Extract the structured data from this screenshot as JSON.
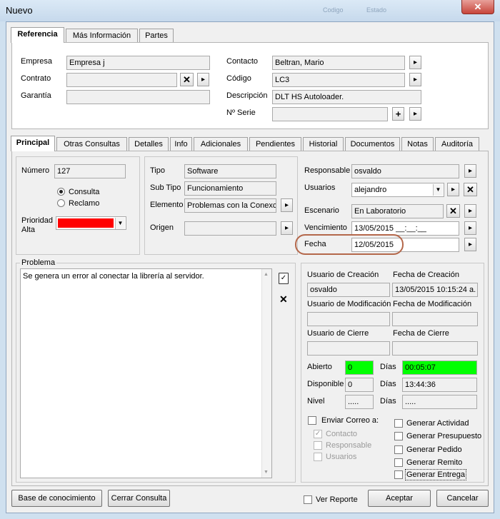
{
  "window": {
    "title": "Nuevo",
    "ghost1": "Codigo",
    "ghost2": "Estado",
    "close": "✕"
  },
  "tabs_top": [
    "Referencia",
    "Más Información",
    "Partes"
  ],
  "ref": {
    "empresa_label": "Empresa",
    "empresa_value": "Empresa j",
    "contrato_label": "Contrato",
    "contrato_value": "",
    "garantia_label": "Garantía",
    "garantia_value": "",
    "contacto_label": "Contacto",
    "contacto_value": "Beltran, Mario",
    "codigo_label": "Código",
    "codigo_value": "LC3",
    "descripcion_label": "Descripción",
    "descripcion_value": "DLT HS Autoloader.",
    "serie_label": "Nº Serie",
    "serie_value": ""
  },
  "tabs_main": [
    "Principal",
    "Otras Consultas",
    "Detalles",
    "Info",
    "Adicionales",
    "Pendientes",
    "Historial",
    "Documentos",
    "Notas",
    "Auditoría"
  ],
  "principal": {
    "numero_label": "Número",
    "numero_value": "127",
    "radio_consulta": "Consulta",
    "radio_reclamo": "Reclamo",
    "prioridad_label": "Prioridad",
    "prioridad_value": "Alta",
    "prioridad_color": "#ff0000",
    "tipo_label": "Tipo",
    "tipo_value": "Software",
    "subtipo_label": "Sub Tipo",
    "subtipo_value": "Funcionamiento",
    "elemento_label": "Elemento",
    "elemento_value": "Problemas con la Conexci",
    "origen_label": "Origen",
    "origen_value": "",
    "responsable_label": "Responsable",
    "responsable_value": "osvaldo",
    "usuarios_label": "Usuarios",
    "usuarios_value": "alejandro",
    "escenario_label": "Escenario",
    "escenario_value": "En Laboratorio",
    "vencimiento_label": "Vencimiento",
    "vencimiento_value": "13/05/2015 __:__:__",
    "fecha_label": "Fecha",
    "fecha_value": "12/05/2015"
  },
  "problema": {
    "label": "Problema",
    "text": "Se genera un error al conectar la librería al servidor."
  },
  "audit": {
    "usr_creacion_label": "Usuario de Creación",
    "usr_creacion_value": "osvaldo",
    "fecha_creacion_label": "Fecha de Creación",
    "fecha_creacion_value": "13/05/2015 10:15:24 a.",
    "usr_mod_label": "Usuario de Modificación",
    "usr_mod_value": "",
    "fecha_mod_label": "Fecha de Modificación",
    "fecha_mod_value": "",
    "usr_cierre_label": "Usuario de Cierre",
    "usr_cierre_value": "",
    "fecha_cierre_label": "Fecha de Cierre",
    "fecha_cierre_value": ""
  },
  "tiempos": {
    "abierto_label": "Abierto",
    "abierto_value": "0",
    "abierto_dias_label": "Días",
    "abierto_dias_value": "00:05:07",
    "disponible_label": "Disponible",
    "disponible_value": "0",
    "disponible_dias_label": "Días",
    "disponible_dias_value": "13:44:36",
    "nivel_label": "Nivel",
    "nivel_value": ".....",
    "nivel_dias_label": "Días",
    "nivel_dias_value": ".....",
    "highlight_color": "#00ff00"
  },
  "correo": {
    "enviar_label": "Enviar Correo a:",
    "contacto_label": "Contacto",
    "responsable_label": "Responsable",
    "usuarios_label": "Usuarios"
  },
  "generar": [
    "Generar Actividad",
    "Generar Presupuesto",
    "Generar Pedido",
    "Generar Remito",
    "Generar Entrega"
  ],
  "footer": {
    "base_label": "Base de conocimiento",
    "cerrar_label": "Cerrar Consulta",
    "ver_reporte_label": "Ver Reporte",
    "aceptar_label": "Aceptar",
    "cancelar_label": "Cancelar"
  },
  "icons": {
    "arrow": "▸",
    "clear": "✕",
    "add": "+",
    "dropdown": "▼",
    "clipboard": "📋",
    "check": "✓"
  }
}
